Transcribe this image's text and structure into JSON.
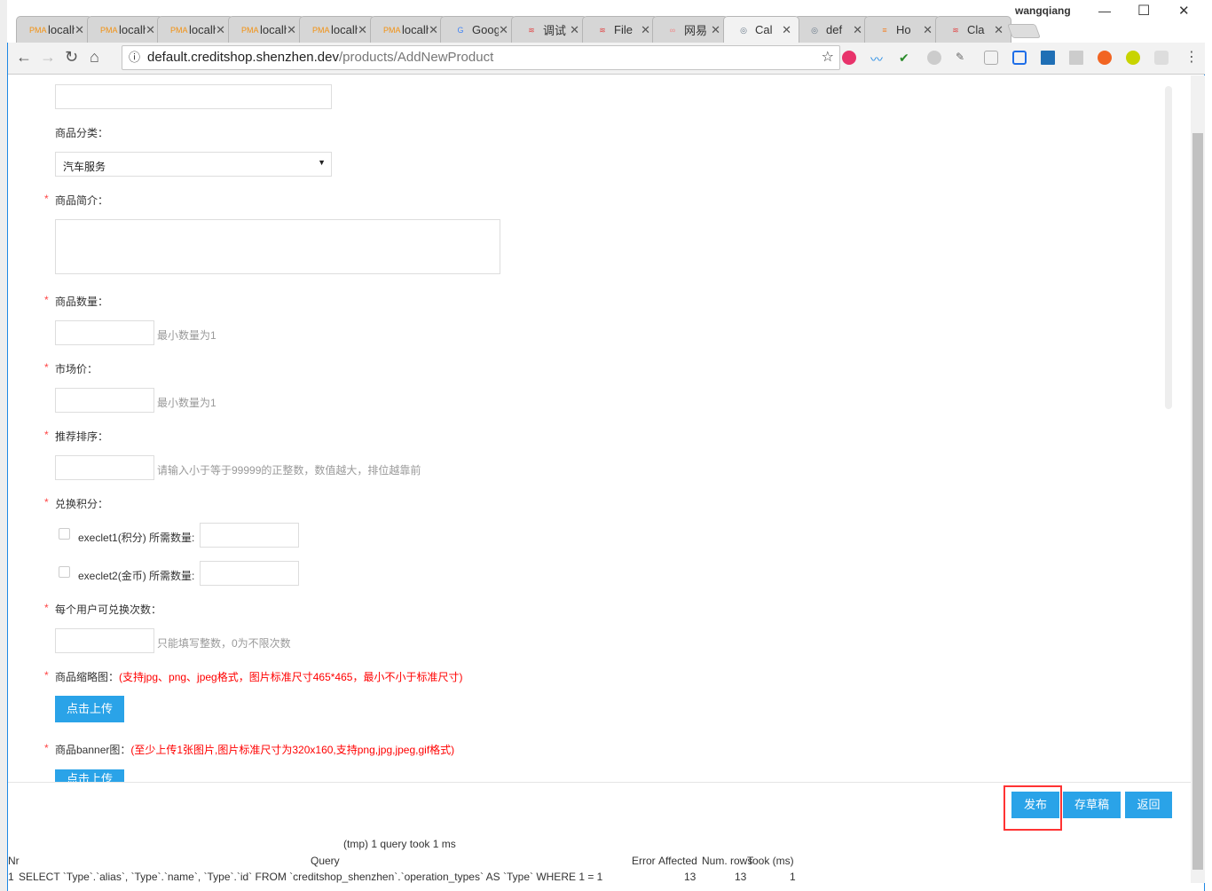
{
  "window": {
    "user": "wangqiang",
    "minimize": "—",
    "maximize": "☐",
    "close": "✕"
  },
  "tabs": [
    {
      "label": "localhost",
      "icon": "PMA"
    },
    {
      "label": "localhost",
      "icon": "PMA"
    },
    {
      "label": "localhost",
      "icon": "PMA"
    },
    {
      "label": "localhost",
      "icon": "PMA"
    },
    {
      "label": "localhost",
      "icon": "PMA"
    },
    {
      "label": "localhost",
      "icon": "PMA"
    },
    {
      "label": "Google",
      "icon": "G"
    },
    {
      "label": "调试",
      "icon": "≋"
    },
    {
      "label": "File",
      "icon": "≋"
    },
    {
      "label": "网易",
      "icon": "∞"
    },
    {
      "label": "Cal",
      "icon": "◎"
    },
    {
      "label": "def",
      "icon": "◎"
    },
    {
      "label": "Ho",
      "icon": "≡"
    },
    {
      "label": "Cla",
      "icon": "≋"
    }
  ],
  "address": {
    "host": "default.creditshop.shenzhen.dev",
    "path": "/products/AddNewProduct"
  },
  "form": {
    "category_label": "商品分类：",
    "category_value": "汽车服务",
    "intro_label": "商品简介：",
    "qty_label": "商品数量：",
    "qty_hint": "最小数量为1",
    "price_label": "市场价：",
    "price_hint": "最小数量为1",
    "sort_label": "推荐排序：",
    "sort_hint": "请输入小于等于99999的正整数，数值越大，排位越靠前",
    "points_label": "兑换积分：",
    "points_opt1": "execlet1(积分) 所需数量:",
    "points_opt2": "execlet2(金币) 所需数量:",
    "limit_label": "每个用户可兑换次数：",
    "limit_hint": "只能填写整数，0为不限次数",
    "thumb_label": "商品缩略图：",
    "thumb_note": "(支持jpg、png、jpeg格式，图片标准尺寸465*465，最小不小于标准尺寸)",
    "upload_label": "点击上传",
    "banner_label": "商品banner图：",
    "banner_note": "(至少上传1张图片,图片标准尺寸为320x160,支持png,jpg,jpeg,gif格式)"
  },
  "footer": {
    "publish": "发布",
    "draft": "存草稿",
    "back": "返回"
  },
  "sqllog": {
    "summary": "(tmp) 1 query took 1 ms",
    "headers": [
      "Nr",
      "Query",
      "Error",
      "Affected",
      "Num. rows",
      "Took (ms)"
    ],
    "row": [
      "1",
      "SELECT `Type`.`alias`, `Type`.`name`, `Type`.`id` FROM `creditshop_shenzhen`.`operation_types` AS `Type` WHERE 1 = 1",
      "",
      "13",
      "13",
      "1"
    ]
  }
}
